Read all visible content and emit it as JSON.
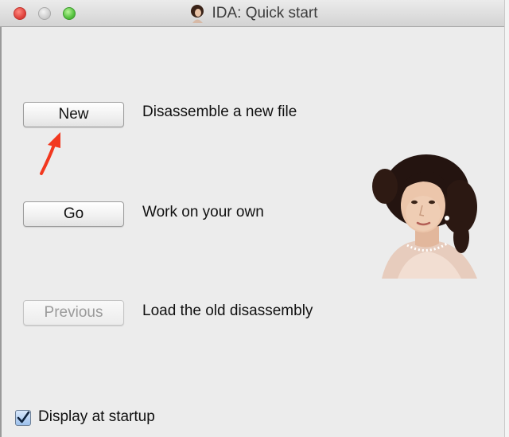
{
  "window": {
    "title": "IDA: Quick start"
  },
  "actions": [
    {
      "label": "New",
      "description": "Disassemble a new file",
      "enabled": true
    },
    {
      "label": "Go",
      "description": "Work on your own",
      "enabled": true
    },
    {
      "label": "Previous",
      "description": "Load the old disassembly",
      "enabled": false
    }
  ],
  "footer": {
    "checkbox_label": "Display at startup",
    "checked": true
  },
  "icons": {
    "title": "portrait-icon",
    "annotation": "red-arrow",
    "illustration": "ida-portrait"
  },
  "colors": {
    "annotation_arrow": "#f2381f",
    "checkbox_fill": "#9cc0ec"
  }
}
